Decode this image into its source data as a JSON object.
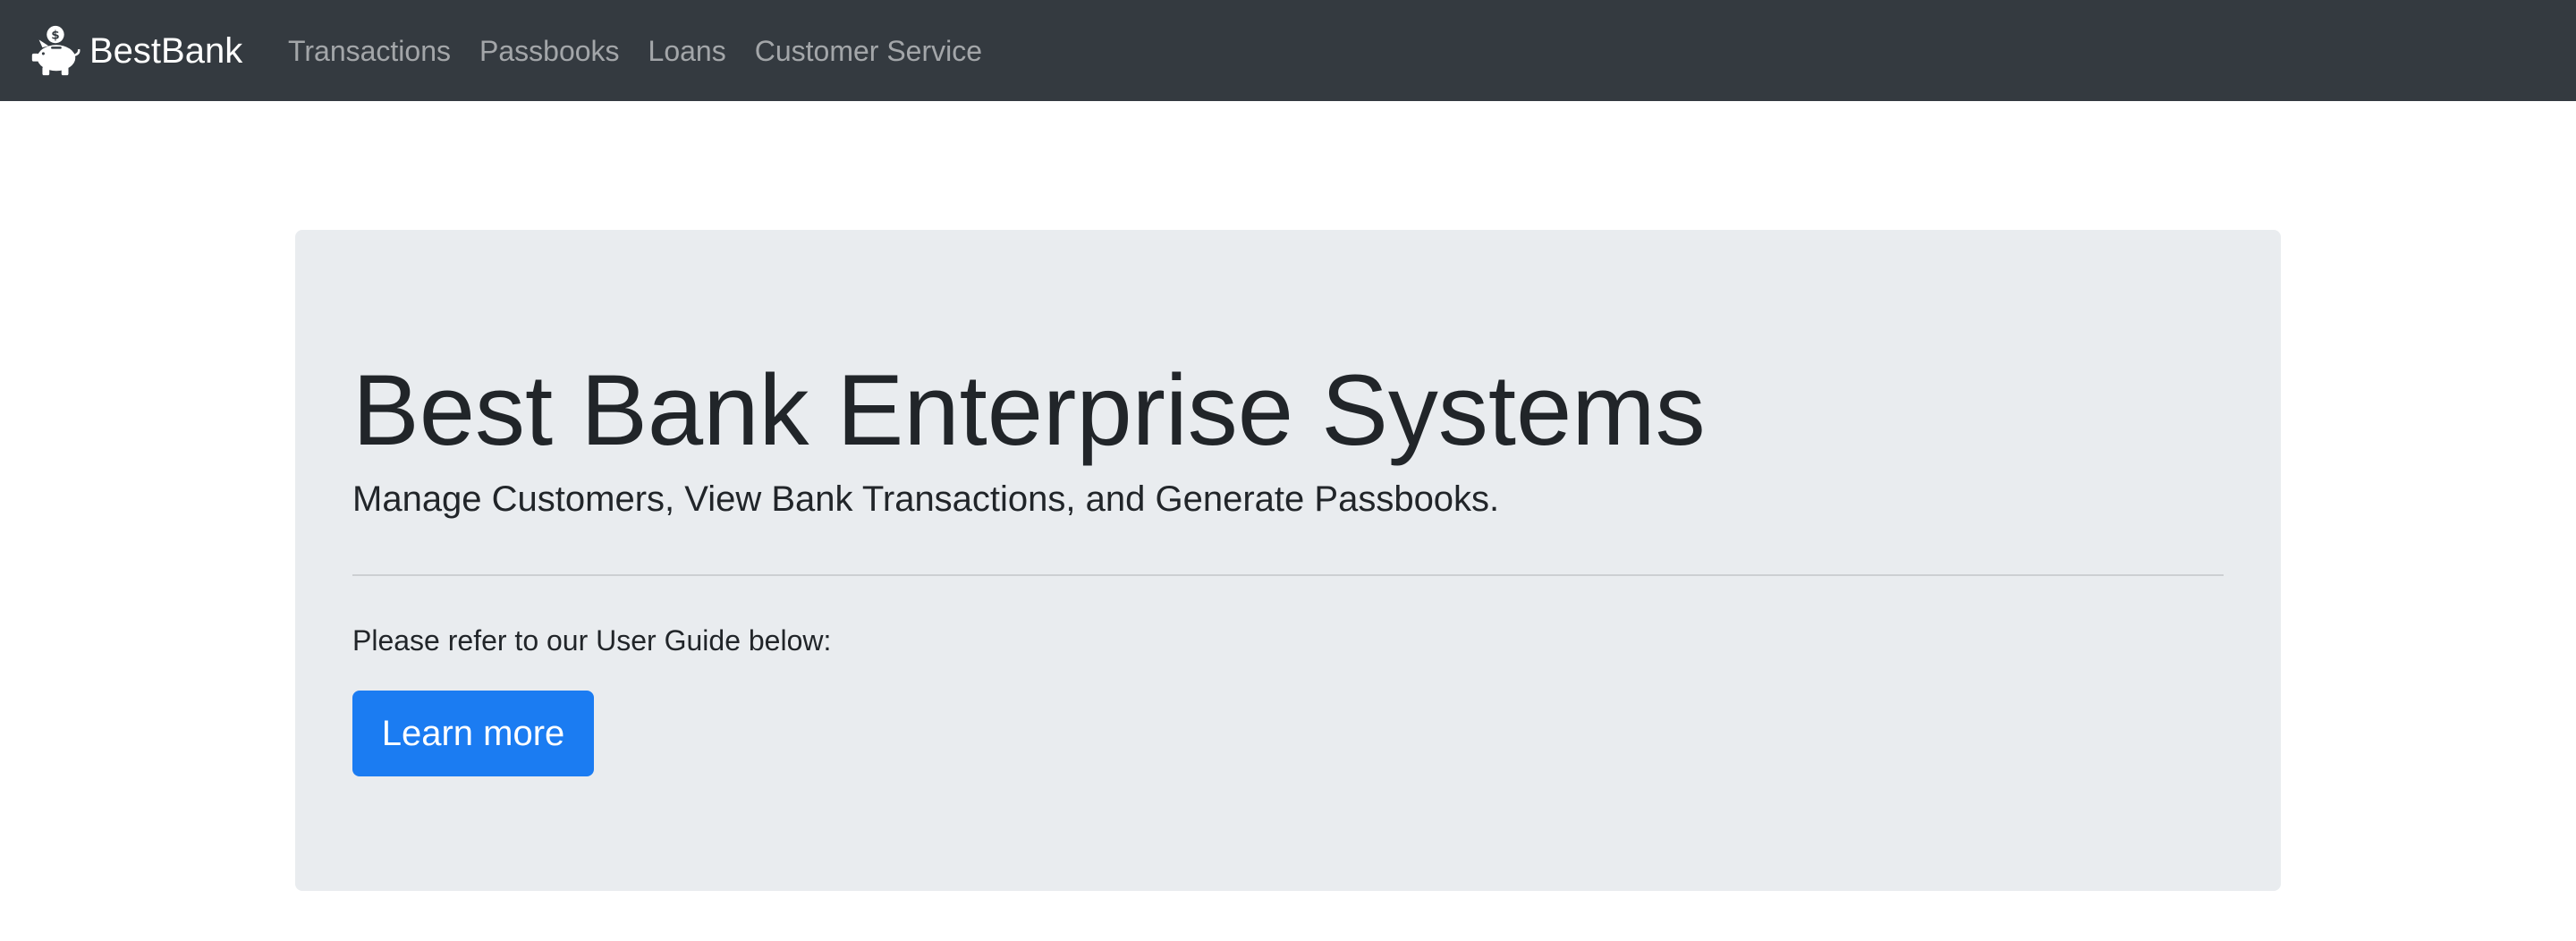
{
  "navbar": {
    "brand": {
      "icon": "piggy-bank-icon",
      "label": "BestBank"
    },
    "links": [
      {
        "label": "Transactions"
      },
      {
        "label": "Passbooks"
      },
      {
        "label": "Loans"
      },
      {
        "label": "Customer Service"
      }
    ]
  },
  "jumbotron": {
    "title": "Best Bank Enterprise Systems",
    "lead": "Manage Customers, View Bank Transactions, and Generate Passbooks.",
    "text": "Please refer to our User Guide below:",
    "button_label": "Learn more"
  },
  "colors": {
    "navbar_bg": "#343a40",
    "jumbotron_bg": "#e9ecef",
    "primary": "#1b7cf2",
    "text": "#212529"
  }
}
